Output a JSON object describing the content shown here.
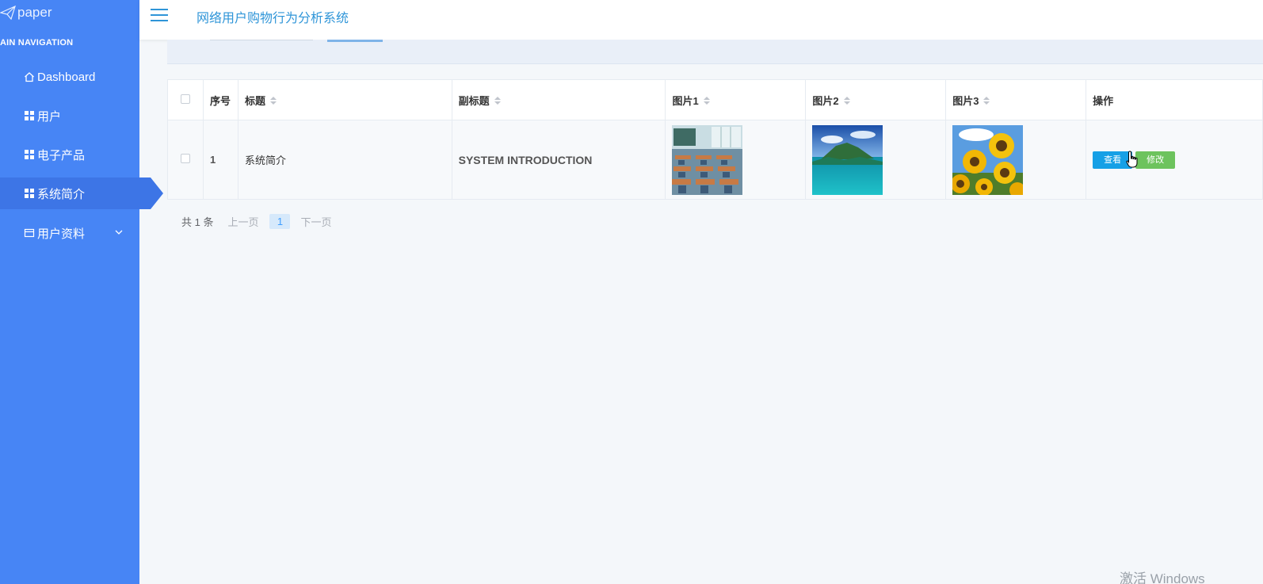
{
  "sidebar": {
    "logo_text": "paper",
    "nav_title": "AIN NAVIGATION",
    "items": [
      {
        "label": "Dashboard",
        "icon": "home-icon"
      },
      {
        "label": "用户",
        "icon": "grid-icon"
      },
      {
        "label": "电子产品",
        "icon": "grid-icon"
      },
      {
        "label": "系统简介",
        "icon": "grid-icon",
        "active": true
      },
      {
        "label": "用户资料",
        "icon": "card-icon",
        "expandable": true
      }
    ]
  },
  "header": {
    "title": "网络用户购物行为分析系统"
  },
  "table": {
    "columns": [
      "序号",
      "标题",
      "副标题",
      "图片1",
      "图片2",
      "图片3",
      "操作"
    ],
    "rows": [
      {
        "index": "1",
        "title": "系统简介",
        "subtitle": "SYSTEM INTRODUCTION",
        "images": [
          "classroom-image",
          "island-lagoon-image",
          "sunflowers-image"
        ],
        "actions": {
          "view": "查看",
          "edit": "修改"
        }
      }
    ]
  },
  "pagination": {
    "total": "共 1 条",
    "prev": "上一页",
    "current": "1",
    "next": "下一页"
  },
  "watermark": "激活 Windows",
  "colors": {
    "sidebar": "#4785f5",
    "sidebar_active": "#3d75e6",
    "accent": "#2f95d8",
    "view_button": "#16a0e6",
    "edit_button": "#6dc35d"
  }
}
